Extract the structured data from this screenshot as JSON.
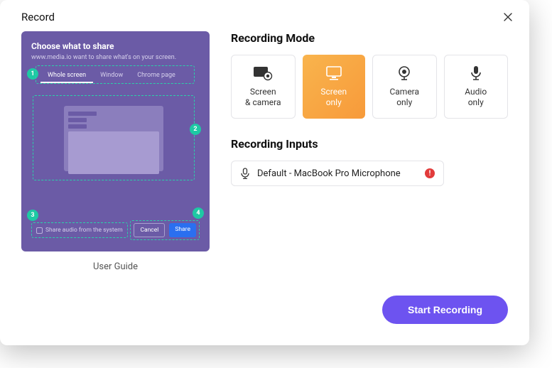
{
  "header": {
    "title": "Record"
  },
  "guide": {
    "title": "Choose what to share",
    "subtitle": "www.media.io want to share what's on your screen.",
    "tabs": [
      "Whole screen",
      "Window",
      "Chrome page"
    ],
    "share_audio_label": "Share audio from the system",
    "cancel_label": "Cancel",
    "share_label": "Share",
    "callouts": [
      "1",
      "2",
      "3",
      "4"
    ],
    "caption": "User Guide"
  },
  "recording_mode": {
    "title": "Recording Mode",
    "options": [
      {
        "id": "screen-camera",
        "label": "Screen\n& camera",
        "active": false
      },
      {
        "id": "screen-only",
        "label": "Screen\nonly",
        "active": true
      },
      {
        "id": "camera-only",
        "label": "Camera\nonly",
        "active": false
      },
      {
        "id": "audio-only",
        "label": "Audio\nonly",
        "active": false
      }
    ]
  },
  "recording_inputs": {
    "title": "Recording Inputs",
    "microphone": "Default - MacBook Pro Microphone",
    "alert": "!"
  },
  "footer": {
    "start_label": "Start Recording"
  }
}
